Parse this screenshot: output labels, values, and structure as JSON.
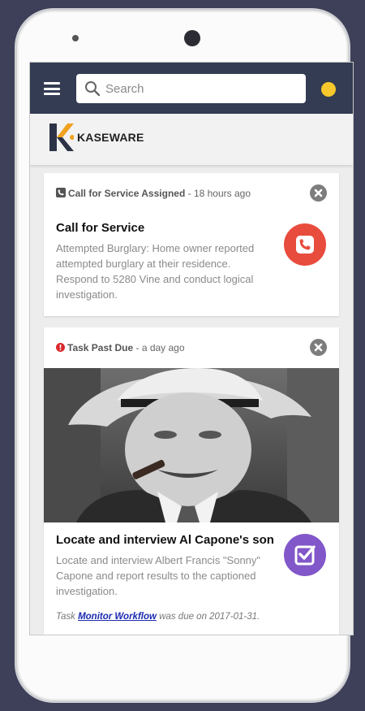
{
  "colors": {
    "background": "#3d4058",
    "topbar": "#333c52",
    "user_dot": "#f7c72c",
    "call_action": "#e84c3d",
    "task_action": "#8257c9",
    "alert_red": "#d8282b",
    "link": "#1b2bb0"
  },
  "header": {
    "menu_icon": "hamburger-icon",
    "search": {
      "placeholder": "Search",
      "value": "",
      "icon": "search-icon"
    },
    "user_indicator": "user-status-dot"
  },
  "brand": {
    "logo_text": "KASEWARE"
  },
  "feed": {
    "cards": [
      {
        "meta_icon": "phone-square-icon",
        "meta_title": "Call for Service Assigned",
        "meta_time": " - 18 hours ago",
        "title": "Call for Service",
        "body": "Attempted Burglary: Home owner reported attempted burglary at their residence. Respond to 5280 Vine and conduct logical investigation.",
        "action_icon": "phone-icon"
      },
      {
        "meta_icon": "exclamation-circle-icon",
        "meta_title": "Task Past Due",
        "meta_time": " - a day ago",
        "title": "Locate and interview Al Capone's son",
        "body": "Locate and interview Albert Francis \"Sonny\" Capone and report results to the captioned investigation.",
        "action_icon": "checkbox-icon",
        "footnote_prefix": "Task ",
        "footnote_link": "Monitor Workflow",
        "footnote_suffix": " was due on 2017-01-31."
      }
    ]
  }
}
